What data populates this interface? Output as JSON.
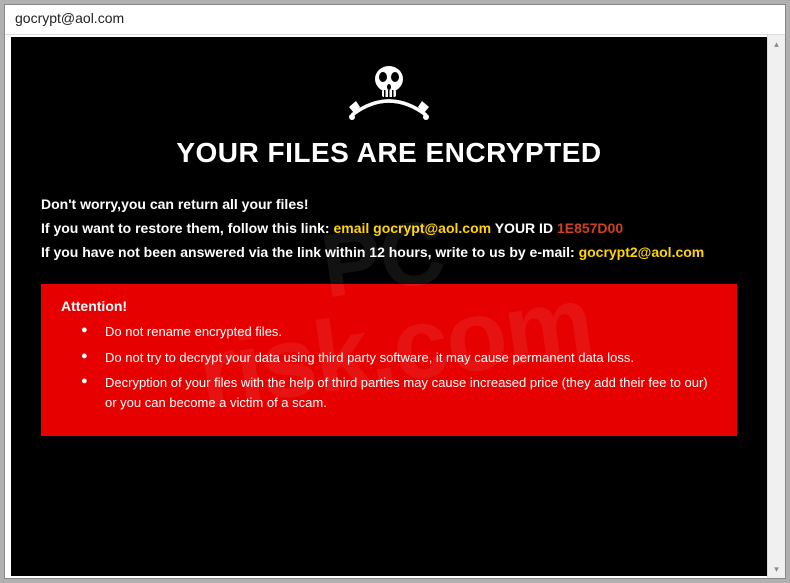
{
  "titlebar": {
    "title": "gocrypt@aol.com"
  },
  "content": {
    "heading": "YOUR FILES ARE ENCRYPTED",
    "line1": "Don't worry,you can return all your files!",
    "line2_a": "If you want to restore them, follow this link: ",
    "line2_email_prefix": "email ",
    "line2_email": "gocrypt@aol.com",
    "line2_yourid_label": "  YOUR ID ",
    "line2_id": "1E857D00",
    "line3_a": "If you have not been answered via the link within 12 hours, write to us by e-mail: ",
    "line3_email": "gocrypt2@aol.com"
  },
  "attention": {
    "title": "Attention!",
    "items": [
      "Do not rename encrypted files.",
      "Do not try to decrypt your data using third party software, it may cause permanent data loss.",
      "Decryption of your files with the help of third parties may cause increased price (they add their fee to our) or you can become a victim of a scam."
    ]
  },
  "watermark": {
    "line1": "PC",
    "line2": "risk.com"
  }
}
